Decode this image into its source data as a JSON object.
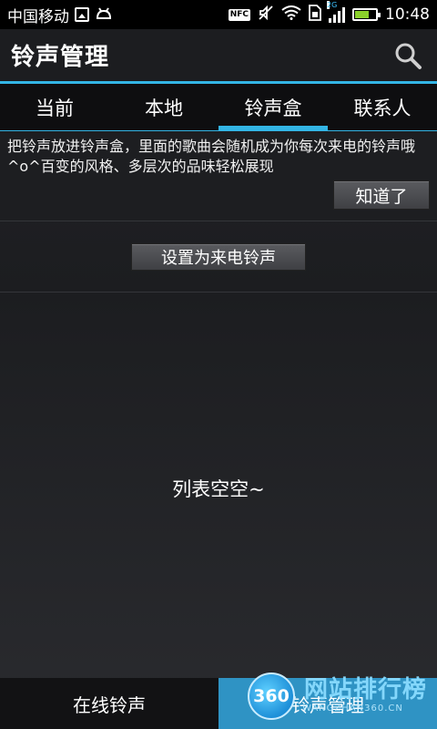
{
  "status_bar": {
    "carrier": "中国移动",
    "network_label": "2G",
    "nfc_label": "NFC",
    "time": "10:48",
    "battery_level": 0.72
  },
  "header": {
    "title": "铃声管理",
    "search_icon": "search-icon"
  },
  "tabs": [
    {
      "label": "当前"
    },
    {
      "label": "本地"
    },
    {
      "label": "铃声盒",
      "active": true
    },
    {
      "label": "联系人"
    }
  ],
  "hint": {
    "text": "把铃声放进铃声盒，里面的歌曲会随机成为你每次来电的铃声哦^o^百变的风格、多层次的品味轻松展现",
    "got_it_label": "知道了"
  },
  "actions": {
    "set_ringtone_label": "设置为来电铃声"
  },
  "list": {
    "empty_text": "列表空空~"
  },
  "bottom_nav": {
    "online_label": "在线铃声",
    "manage_label": "铃声管理"
  },
  "watermark": {
    "badge": "360",
    "main": "网站排行榜",
    "sub": "WANGZHAN360.CN"
  },
  "colors": {
    "accent": "#33b5e5",
    "bottom_active": "#2f93c4",
    "battery": "#8bd12c"
  }
}
